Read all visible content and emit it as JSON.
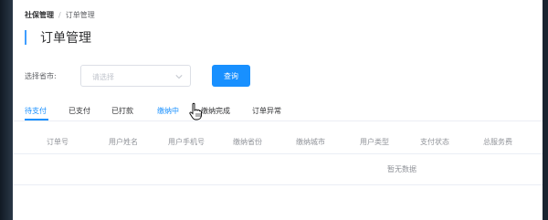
{
  "breadcrumb": {
    "root": "社保管理",
    "separator": "/",
    "current": "订单管理"
  },
  "page": {
    "title": "订单管理"
  },
  "filter": {
    "label": "选择省市:",
    "placeholder": "请选择",
    "query_button": "查询"
  },
  "tabs": [
    {
      "label": "待支付",
      "active": true
    },
    {
      "label": "已支付"
    },
    {
      "label": "已打款"
    },
    {
      "label": "缴纳中"
    },
    {
      "label": "缴纳完成"
    },
    {
      "label": "订单异常"
    }
  ],
  "table": {
    "columns": [
      "订单号",
      "用户姓名",
      "用户手机号",
      "缴纳省份",
      "缴纳城市",
      "用户类型",
      "支付状态",
      "总服务费"
    ],
    "empty_text": "暂无数据"
  },
  "colors": {
    "accent": "#1890ff",
    "title_bar": "#409eff"
  }
}
